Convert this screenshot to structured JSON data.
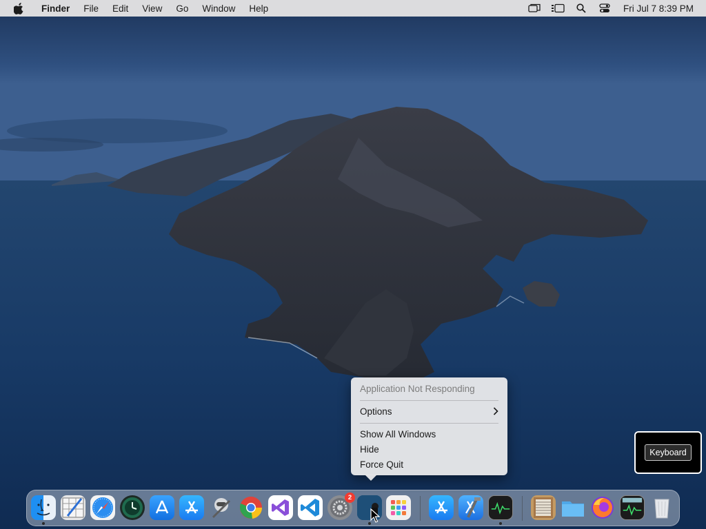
{
  "menubar": {
    "app_name": "Finder",
    "items": [
      "File",
      "Edit",
      "View",
      "Go",
      "Window",
      "Help"
    ],
    "clock": "Fri Jul 7  8:39 PM",
    "status_icons": [
      "screen-mirroring-icon",
      "stage-manager-icon",
      "spotlight-search-icon",
      "control-center-icon"
    ]
  },
  "context_menu": {
    "header": "Application Not Responding",
    "options": "Options",
    "show_all_windows": "Show All Windows",
    "hide": "Hide",
    "force_quit": "Force Quit"
  },
  "keyboard_badge": {
    "label": "Keyboard"
  },
  "dock": {
    "apps": [
      {
        "icon": "finder-icon",
        "running": true
      },
      {
        "icon": "script-editor-icon",
        "running": false
      },
      {
        "icon": "safari-icon",
        "running": false
      },
      {
        "icon": "time-machine-icon",
        "running": false
      },
      {
        "icon": "testflight-icon",
        "running": false
      },
      {
        "icon": "app-store-icon",
        "running": false
      },
      {
        "icon": "automator-icon",
        "running": false
      },
      {
        "icon": "chrome-icon",
        "running": false
      },
      {
        "icon": "visual-studio-icon",
        "running": false
      },
      {
        "icon": "vscode-icon",
        "running": false
      },
      {
        "icon": "system-preferences-icon",
        "running": false,
        "badge": "2"
      },
      {
        "icon": "unresponsive-app-icon",
        "running": true
      },
      {
        "icon": "launchpad-icon",
        "running": false
      },
      {
        "icon": "app-store-icon",
        "running": false
      },
      {
        "icon": "xcode-icon",
        "running": false
      },
      {
        "icon": "activity-monitor-icon",
        "running": true
      },
      {
        "icon": "archive-utility-icon",
        "running": false
      },
      {
        "icon": "folder-icon",
        "running": false
      },
      {
        "icon": "firefox-icon",
        "running": false
      },
      {
        "icon": "activity-monitor-icon",
        "running": false
      },
      {
        "icon": "trash-icon",
        "running": false
      }
    ]
  },
  "colors": {
    "menubar_bg": "#dcdcde",
    "badge_red": "#f23b30",
    "wallpaper_sky": "#2b4a78",
    "wallpaper_sea": "#16345e"
  }
}
